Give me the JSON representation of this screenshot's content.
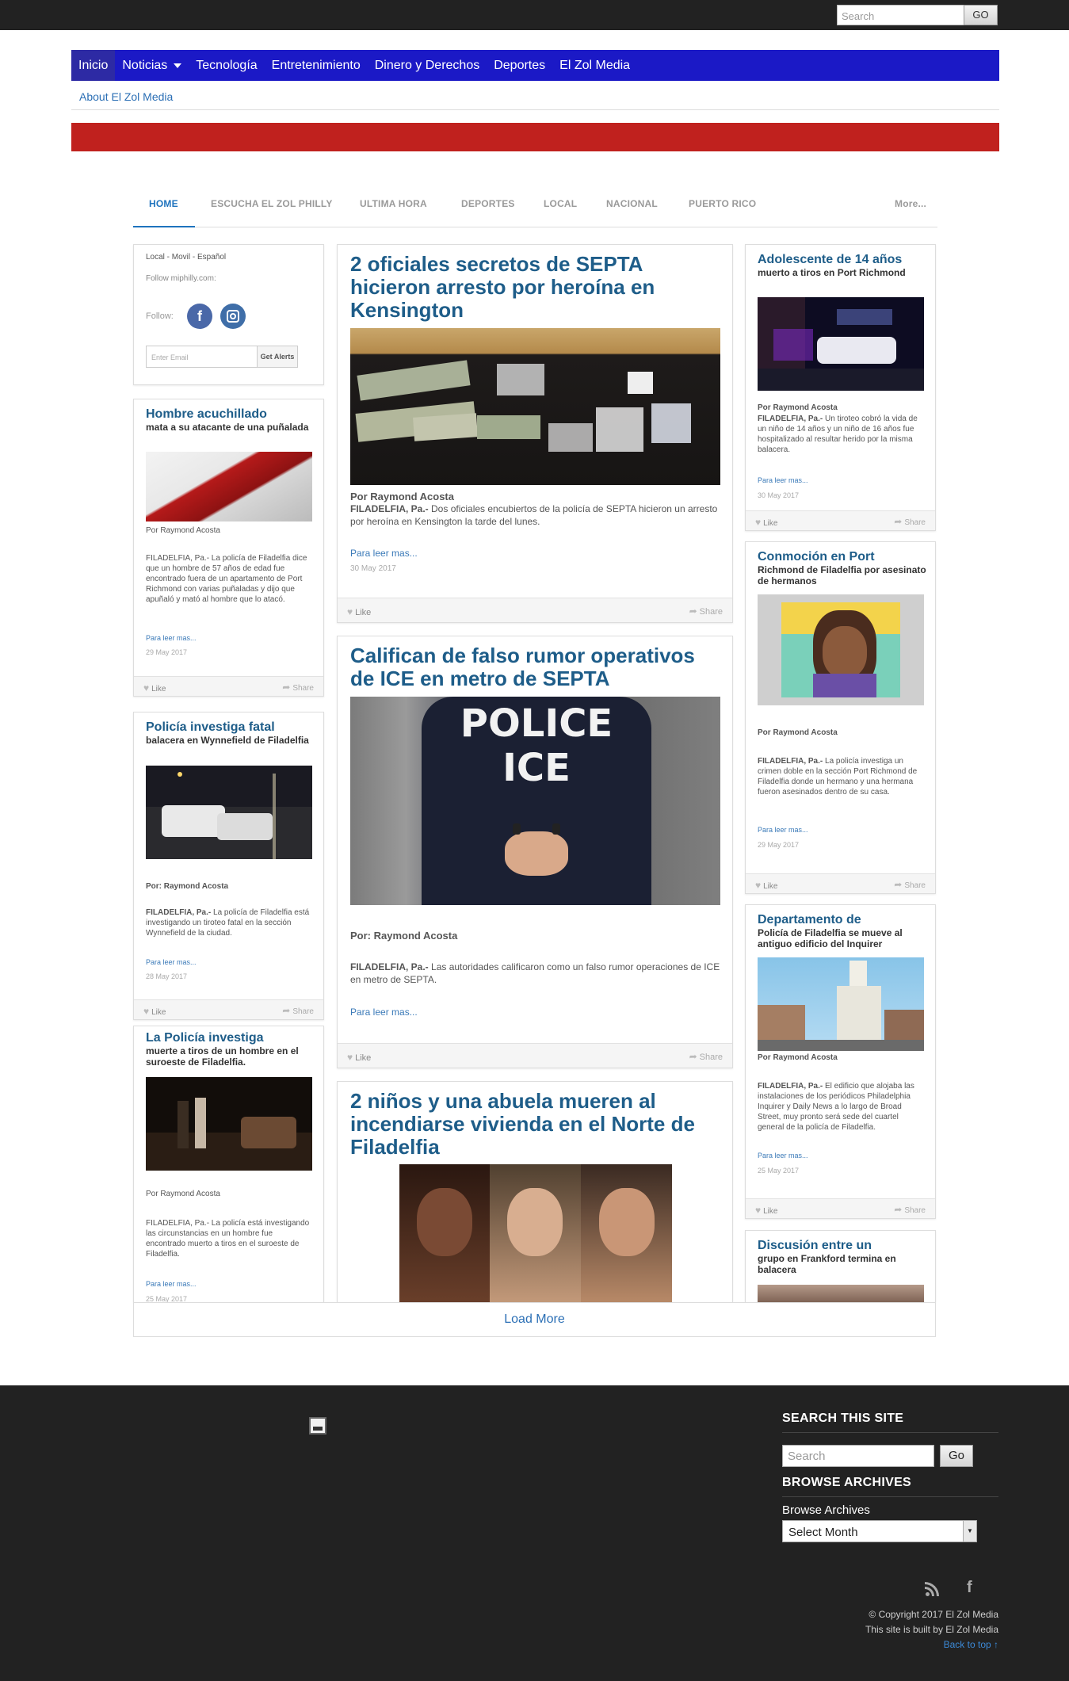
{
  "topbar": {
    "search_placeholder": "Search",
    "go_label": "GO"
  },
  "nav": {
    "items": [
      "Inicio",
      "Noticias",
      "Tecnología",
      "Entretenimiento",
      "Dinero y Derechos",
      "Deportes",
      "El Zol Media"
    ],
    "sub_link": "About El Zol Media"
  },
  "tabs": {
    "items": [
      "HOME",
      "ESCUCHA EL ZOL PHILLY",
      "ULTIMA HORA",
      "DEPORTES",
      "LOCAL",
      "NACIONAL",
      "PUERTO RICO"
    ],
    "more": "More..."
  },
  "social_card": {
    "tagline": "Local - Movil - Español",
    "follow_text": "Follow miphilly.com:",
    "follow_label": "Follow:",
    "email_placeholder": "Enter Email",
    "alerts_button": "Get Alerts"
  },
  "common": {
    "like": "Like",
    "share": "Share",
    "read_more": "Para leer mas...",
    "load_more": "Load More"
  },
  "left_cards": [
    {
      "headline": "Hombre acuchillado",
      "sub": "mata a su atacante de una puñalada",
      "byline": "Por Raymond Acosta",
      "body": "FILADELFIA, Pa.- La policía de Filadelfia dice que un hombre de 57 años de edad fue encontrado fuera de un apartamento de Port Richmond con varias puñaladas y dijo que apuñaló y mató al hombre que lo atacó.",
      "date": "29 May 2017"
    },
    {
      "headline": "Policía investiga fatal",
      "sub": "balacera en Wynnefield de Filadelfia",
      "byline": "Por: Raymond Acosta",
      "body_lead": "FILADELFIA, Pa.-",
      "body": "La policía de Filadelfia está investigando un tiroteo fatal en la sección Wynnefield de la ciudad.",
      "date": "28 May 2017"
    },
    {
      "headline": "La Policía investiga",
      "sub": "muerte a tiros de un hombre en el suroeste de Filadelfia.",
      "byline": "Por Raymond Acosta",
      "body": "FILADELFIA, Pa.- La policía está investigando las circunstancias en un hombre fue encontrado muerto a tiros en el suroeste de Filadelfia.",
      "date": "25 May 2017"
    }
  ],
  "center_cards": [
    {
      "headline": "2 oficiales secretos de SEPTA hicieron arresto por heroína en Kensington",
      "byline": "Por Raymond Acosta",
      "body_lead": "FILADELFIA, Pa.-",
      "body": "Dos oficiales encubiertos de la policía de SEPTA hicieron un arresto por heroína en Kensington la tarde del lunes.",
      "date": "30 May 2017"
    },
    {
      "headline": "Califican de falso rumor operativos de ICE en metro de SEPTA",
      "byline": "Por: Raymond Acosta",
      "body_lead": "FILADELFIA, Pa.-",
      "body": "Las autoridades calificaron como un falso rumor operaciones de ICE en metro de SEPTA.",
      "image_text": "POLICE\nICE"
    },
    {
      "headline": "2 niños y una abuela mueren al incendiarse vivienda en el Norte de Filadelfia"
    }
  ],
  "right_cards": [
    {
      "headline": "Adolescente de 14 años",
      "sub": "muerto a tiros en Port Richmond",
      "byline": "Por Raymond Acosta",
      "body_lead": "FILADELFIA, Pa.-",
      "body": "Un tiroteo cobró la vida de un niño de 14 años y un niño de 16 años fue hospitalizado al resultar herido por la misma balacera.",
      "date": "30 May 2017"
    },
    {
      "headline": "Conmoción en Port",
      "sub": "Richmond de Filadelfia por asesinato de hermanos",
      "byline": "Por Raymond Acosta",
      "body_lead": "FILADELFIA, Pa.-",
      "body": "La policía investiga un crimen doble en la sección Port Richmond de Filadelfia donde un hermano y una hermana fueron asesinados dentro de su casa.",
      "date": "29 May 2017"
    },
    {
      "headline": "Departamento de",
      "sub": "Policía de Filadelfia se mueve al antiguo edificio del Inquirer",
      "byline": "Por Raymond Acosta",
      "body_lead": "FILADELFIA, Pa.-",
      "body": "El edificio que alojaba las instalaciones de los periódicos Philadelphia Inquirer y Daily News a lo largo de Broad Street, muy pronto será sede del cuartel general de la policía de Filadelfia.",
      "date": "25 May 2017"
    },
    {
      "headline": "Discusión entre un",
      "sub": "grupo en Frankford termina en balacera"
    }
  ],
  "footer": {
    "search_title": "SEARCH THIS SITE",
    "search_placeholder": "Search",
    "go_label": "Go",
    "archives_title": "BROWSE ARCHIVES",
    "archives_label": "Browse Archives",
    "select_value": "Select Month",
    "copyright": "© Copyright 2017 El Zol Media",
    "built_by": "This site is built by El Zol Media",
    "back_to_top": "Back to top ↑"
  },
  "colors": {
    "nav_bg": "#1b19c6",
    "red_band": "#c0211e",
    "headline": "#1e5d89",
    "footer_bg": "#222222",
    "link": "#2b6fb5"
  }
}
